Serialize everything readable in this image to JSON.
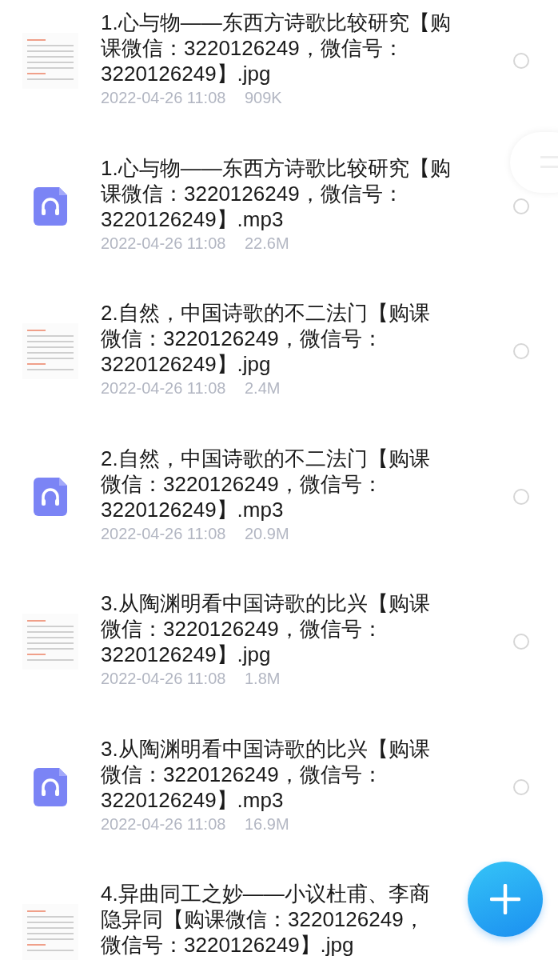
{
  "files": [
    {
      "kind": "image",
      "title": [
        "1.心与物——东西方诗歌比较研究【购",
        "课微信：3220126249，微信号：",
        "3220126249】.jpg"
      ],
      "date": "2022-04-26 11:08",
      "size": "909K",
      "selected": false
    },
    {
      "kind": "audio",
      "title": [
        "1.心与物——东西方诗歌比较研究【购",
        "课微信：3220126249，微信号：",
        "3220126249】.mp3"
      ],
      "date": "2022-04-26 11:08",
      "size": "22.6M",
      "selected": false
    },
    {
      "kind": "image",
      "title": [
        "2.自然，中国诗歌的不二法门【购课",
        "微信：3220126249，微信号：",
        "3220126249】.jpg"
      ],
      "date": "2022-04-26 11:08",
      "size": "2.4M",
      "selected": false
    },
    {
      "kind": "audio",
      "title": [
        "2.自然，中国诗歌的不二法门【购课",
        "微信：3220126249，微信号：",
        "3220126249】.mp3"
      ],
      "date": "2022-04-26 11:08",
      "size": "20.9M",
      "selected": false
    },
    {
      "kind": "image",
      "title": [
        "3.从陶渊明看中国诗歌的比兴【购课",
        "微信：3220126249，微信号：",
        "3220126249】.jpg"
      ],
      "date": "2022-04-26 11:08",
      "size": "1.8M",
      "selected": false
    },
    {
      "kind": "audio",
      "title": [
        "3.从陶渊明看中国诗歌的比兴【购课",
        "微信：3220126249，微信号：",
        "3220126249】.mp3"
      ],
      "date": "2022-04-26 11:08",
      "size": "16.9M",
      "selected": false
    },
    {
      "kind": "image",
      "title": [
        "4.异曲同工之妙——小议杜甫、李商",
        "隐异同【购课微信：3220126249，",
        "微信号：3220126249】.jpg"
      ]
    }
  ]
}
